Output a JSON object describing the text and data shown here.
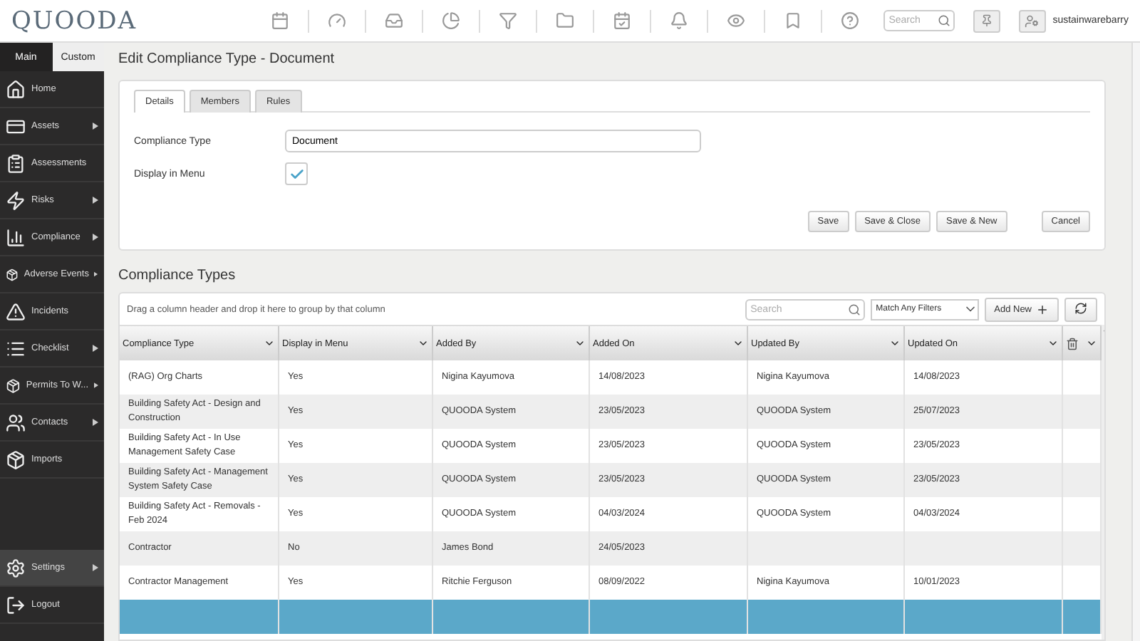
{
  "header": {
    "logo": "QUOODA",
    "search": {
      "placeholder": "Search"
    },
    "user": "sustainwarebarry"
  },
  "sidebar": {
    "tabs": [
      {
        "label": "Main",
        "selected": true
      },
      {
        "label": "Custom",
        "selected": false
      }
    ],
    "items": [
      {
        "label": "Home",
        "kind": "home",
        "expandable": false,
        "selected": false
      },
      {
        "label": "Assets",
        "kind": "assets",
        "expandable": true,
        "selected": false
      },
      {
        "label": "Assessments",
        "kind": "clipboard",
        "expandable": false,
        "selected": false
      },
      {
        "label": "Risks",
        "kind": "bolt",
        "expandable": true,
        "selected": false
      },
      {
        "label": "Compliance",
        "kind": "bars",
        "expandable": true,
        "selected": false
      },
      {
        "label": "Adverse Events",
        "kind": "box",
        "expandable": true,
        "selected": false
      },
      {
        "label": "Incidents",
        "kind": "warning",
        "expandable": false,
        "selected": false
      },
      {
        "label": "Checklist",
        "kind": "list",
        "expandable": true,
        "selected": false
      },
      {
        "label": "Permits To W...",
        "kind": "box",
        "expandable": true,
        "selected": false
      },
      {
        "label": "Contacts",
        "kind": "people",
        "expandable": true,
        "selected": false
      },
      {
        "label": "Imports",
        "kind": "box",
        "expandable": false,
        "selected": false
      }
    ],
    "bottom_items": [
      {
        "label": "Settings",
        "kind": "gear",
        "expandable": true,
        "selected": true
      },
      {
        "label": "Logout",
        "kind": "logout",
        "expandable": false,
        "selected": false
      }
    ]
  },
  "page_title": "Edit Compliance Type - Document",
  "form": {
    "tabs": [
      {
        "label": "Details",
        "selected": true
      },
      {
        "label": "Members",
        "selected": false
      },
      {
        "label": "Rules",
        "selected": false
      }
    ],
    "fields": [
      {
        "label": "Compliance Type",
        "kind": "text",
        "value": "Document"
      },
      {
        "label": "Display in Menu",
        "kind": "checkbox",
        "checked": true
      }
    ],
    "buttons": [
      "Save",
      "Save & Close",
      "Save & New"
    ],
    "cancel": "Cancel"
  },
  "grid": {
    "title": "Compliance Types",
    "group_hint": "Drag a column header and drop it here to group by that column",
    "search": {
      "placeholder": "Search"
    },
    "filter": "Match Any Filters",
    "add_button": "Add New",
    "columns": [
      "Compliance Type",
      "Display in Menu",
      "Added By",
      "Added On",
      "Updated By",
      "Updated On"
    ],
    "rows": [
      {
        "selected": false,
        "cells": [
          "(RAG) Org Charts",
          "Yes",
          "Nigina Kayumova",
          "14/08/2023",
          "Nigina Kayumova",
          "14/08/2023"
        ]
      },
      {
        "selected": false,
        "cells": [
          "Building Safety Act - Design and Construction",
          "Yes",
          "QUOODA System",
          "23/05/2023",
          "QUOODA System",
          "25/07/2023"
        ]
      },
      {
        "selected": false,
        "cells": [
          "Building Safety Act - In Use Management Safety Case",
          "Yes",
          "QUOODA System",
          "23/05/2023",
          "QUOODA System",
          "23/05/2023"
        ]
      },
      {
        "selected": false,
        "cells": [
          "Building Safety Act - Management System Safety Case",
          "Yes",
          "QUOODA System",
          "23/05/2023",
          "QUOODA System",
          "23/05/2023"
        ]
      },
      {
        "selected": false,
        "cells": [
          "Building Safety Act - Removals - Feb 2024",
          "Yes",
          "QUOODA System",
          "04/03/2024",
          "QUOODA System",
          "04/03/2024"
        ]
      },
      {
        "selected": false,
        "cells": [
          "Contractor",
          "No",
          "James Bond",
          "24/05/2023"
        ]
      },
      {
        "selected": false,
        "cells": [
          "Contractor Management",
          "Yes",
          "Ritchie Ferguson",
          "08/09/2022",
          "Nigina Kayumova",
          "10/01/2023"
        ]
      },
      {
        "selected": true
      }
    ]
  }
}
